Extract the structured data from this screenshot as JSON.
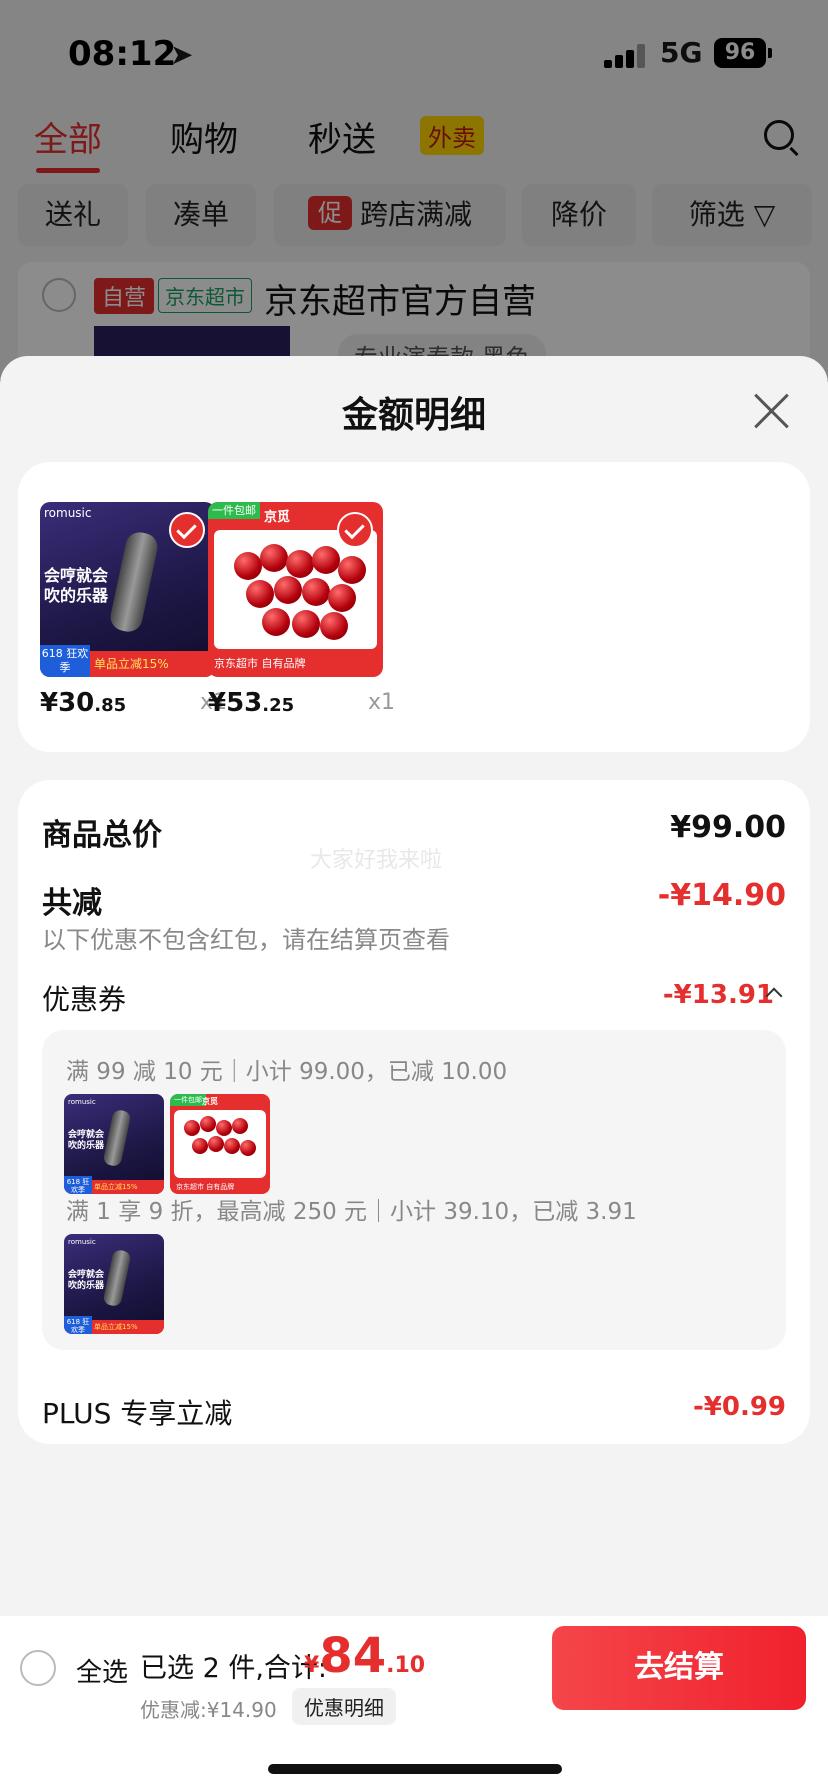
{
  "status_bar": {
    "time": "08:12",
    "network": "5G",
    "battery": "96"
  },
  "top_tabs": {
    "all": "全部",
    "shopping": "购物",
    "fast": "秒送",
    "takeout_badge": "外卖"
  },
  "filter_chips": {
    "gift": "送礼",
    "bundle": "凑单",
    "promo_icon": "促",
    "cross_store": "跨店满减",
    "price_drop": "降价",
    "filter": "筛选"
  },
  "shop": {
    "self_tag": "自营",
    "market_tag": "京东超市",
    "name": "京东超市官方自营",
    "spec": "专业演奏款 黑色"
  },
  "sheet": {
    "title": "金额明细",
    "products": [
      {
        "name": "harmonica-mic-product",
        "price_int": "¥30",
        "price_dec": ".85",
        "qty": "x1",
        "img_brand": "romusic",
        "img_text": "会哼就会吹的乐器",
        "img_band": "单品立减15%",
        "img_618": "618 狂欢季"
      },
      {
        "name": "cherry-product",
        "price_int": "¥53",
        "price_dec": ".25",
        "qty": "x1",
        "img_tag": "一件包邮",
        "img_logo": "京觅",
        "img_band": "京东超市 自有品牌"
      }
    ],
    "summary": {
      "total_label": "商品总价",
      "total_value": "¥99.00",
      "reduce_label": "共减",
      "reduce_value": "-¥14.90",
      "note": "以下优惠不包含红包，请在结算页查看",
      "watermark": "大家好我来啦",
      "coupon_label": "优惠券",
      "coupon_value": "-¥13.91",
      "coupon_rule1": "满 99 减 10 元｜小计 99.00，已减 10.00",
      "coupon_rule2": "满 1 享 9 折，最高减 250 元｜小计 39.10，已减 3.91",
      "plus_label": "PLUS 专享立减",
      "plus_value": "-¥0.99"
    }
  },
  "bottom_bar": {
    "select_all": "全选",
    "selected": "已选 2 件,合计:",
    "total_yen": "¥",
    "total_int": "84",
    "total_dec": ".10",
    "discount": "优惠减:¥14.90",
    "discount_detail": "优惠明细",
    "checkout": "去结算"
  },
  "colors": {
    "accent": "#e52e2e",
    "takeout_badge": "#ffd500",
    "market_green": "#1aa260"
  }
}
